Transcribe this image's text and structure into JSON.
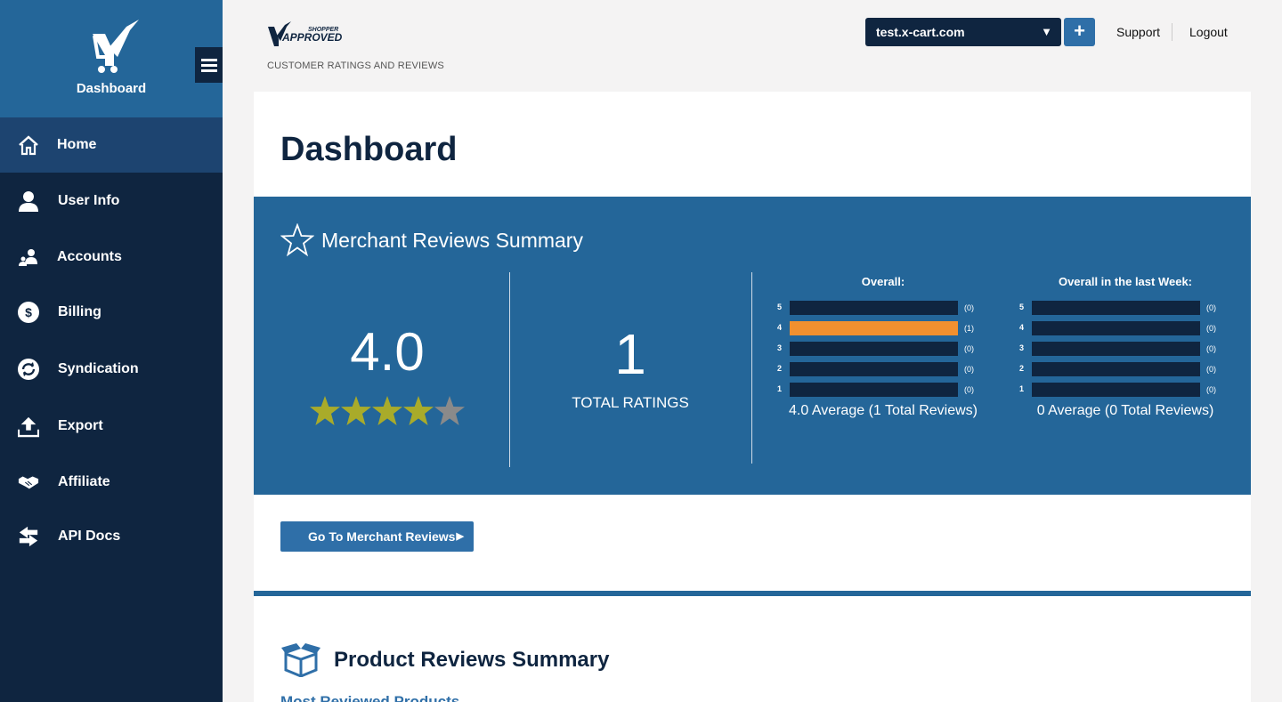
{
  "colors": {
    "sidebar_bg": "#0f2540",
    "sidebar_header": "#246699",
    "active_item": "#1d4470",
    "accent_blue": "#2f6fa8",
    "bar_fill": "#f1902f",
    "star_gold": "#a9ab2a",
    "star_grey": "#8a8a8a"
  },
  "sidebar": {
    "title": "Dashboard",
    "items": [
      {
        "label": "Home",
        "icon": "home-icon",
        "active": true
      },
      {
        "label": "User Info",
        "icon": "user-icon"
      },
      {
        "label": "Accounts",
        "icon": "accounts-icon"
      },
      {
        "label": "Billing",
        "icon": "dollar-icon"
      },
      {
        "label": "Syndication",
        "icon": "sync-icon"
      },
      {
        "label": "Export",
        "icon": "upload-icon"
      },
      {
        "label": "Affiliate",
        "icon": "handshake-icon"
      },
      {
        "label": "API Docs",
        "icon": "arrows-icon"
      }
    ]
  },
  "header": {
    "brand_subtitle": "CUSTOMER RATINGS AND REVIEWS",
    "site_selected": "test.x-cart.com",
    "add_label": "+",
    "support_label": "Support",
    "logout_label": "Logout"
  },
  "main": {
    "page_title": "Dashboard",
    "merchant": {
      "title": "Merchant Reviews Summary",
      "average": "4.0",
      "star_rating": 4,
      "total_ratings": "1",
      "total_label": "TOTAL RATINGS",
      "overall": {
        "heading": "Overall:",
        "rows": [
          {
            "star": "5",
            "count": "(0)",
            "fraction": 0
          },
          {
            "star": "4",
            "count": "(1)",
            "fraction": 1
          },
          {
            "star": "3",
            "count": "(0)",
            "fraction": 0
          },
          {
            "star": "2",
            "count": "(0)",
            "fraction": 0
          },
          {
            "star": "1",
            "count": "(0)",
            "fraction": 0
          }
        ],
        "summary": "4.0 Average (1 Total Reviews)"
      },
      "last_week": {
        "heading": "Overall in the last Week:",
        "rows": [
          {
            "star": "5",
            "count": "(0)",
            "fraction": 0
          },
          {
            "star": "4",
            "count": "(0)",
            "fraction": 0
          },
          {
            "star": "3",
            "count": "(0)",
            "fraction": 0
          },
          {
            "star": "2",
            "count": "(0)",
            "fraction": 0
          },
          {
            "star": "1",
            "count": "(0)",
            "fraction": 0
          }
        ],
        "summary": "0 Average (0 Total Reviews)"
      }
    },
    "go_button_label": "Go To Merchant Reviews",
    "product": {
      "title": "Product Reviews Summary",
      "most_reviewed_link": "Most Reviewed Products"
    }
  }
}
